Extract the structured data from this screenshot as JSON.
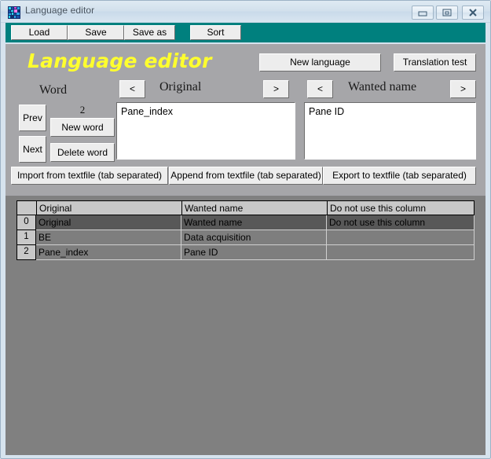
{
  "window": {
    "title": "Language editor",
    "icon": "labview-app-icon",
    "controls": [
      {
        "name": "minimize-button",
        "glyph": "minimize-icon"
      },
      {
        "name": "maximize-button",
        "glyph": "maximize-icon"
      },
      {
        "name": "close-button",
        "glyph": "close-icon"
      }
    ]
  },
  "toolbar": {
    "background_color": "#00807e",
    "buttons": [
      {
        "label": "Load"
      },
      {
        "label": "Save"
      },
      {
        "label": "Save as"
      },
      {
        "label": "Sort"
      }
    ]
  },
  "panel": {
    "heading": "Language editor",
    "heading_color": "#ffff2e",
    "background_color": "#a6a6a9"
  },
  "word_nav": {
    "section_label": "Word",
    "counter_value": "2",
    "prev_label": "Prev",
    "next_label": "Next",
    "new_word_label": "New word",
    "delete_word_label": "Delete word"
  },
  "original": {
    "label": "Original",
    "prev_arrow": "<",
    "next_arrow": ">",
    "value": "Pane_index"
  },
  "wanted": {
    "label": "Wanted name",
    "prev_arrow": "<",
    "next_arrow": ">",
    "value": "Pane ID"
  },
  "language_actions": {
    "new_language_label": "New language",
    "translation_test_label": "Translation test"
  },
  "file_actions": {
    "import_label": "Import from textfile (tab separated)",
    "append_label": "Append from textfile (tab separated)",
    "export_label": "Export to textfile (tab separated)"
  },
  "table": {
    "headers": [
      "Original",
      "Wanted name",
      "Do not use this column"
    ],
    "rows": [
      {
        "index": "0",
        "selected": true,
        "cells": [
          "Original",
          "Wanted name",
          "Do not use this column"
        ]
      },
      {
        "index": "1",
        "selected": false,
        "cells": [
          "BE",
          "Data acquisition",
          ""
        ]
      },
      {
        "index": "2",
        "selected": false,
        "cells": [
          "Pane_index",
          "Pane ID",
          ""
        ]
      }
    ]
  }
}
